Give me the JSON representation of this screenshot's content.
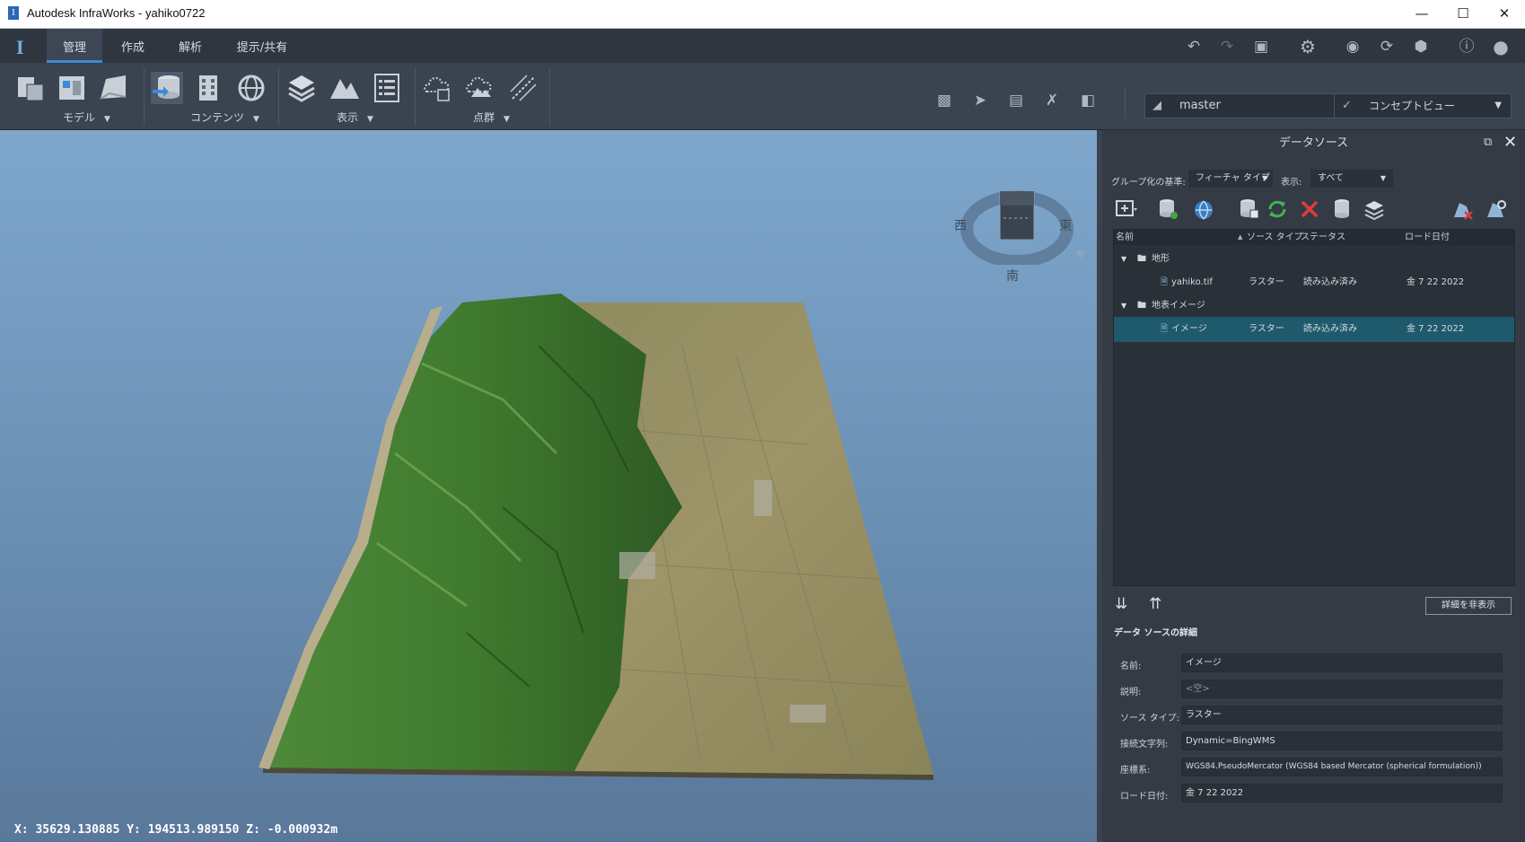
{
  "window": {
    "title": "Autodesk InfraWorks - yahiko0722",
    "app_icon": "I"
  },
  "ribbon": {
    "logo": "I",
    "tabs": [
      {
        "label": "管理",
        "active": true
      },
      {
        "label": "作成",
        "active": false
      },
      {
        "label": "解析",
        "active": false
      },
      {
        "label": "提示/共有",
        "active": false
      }
    ],
    "groups": [
      {
        "label": "モデル"
      },
      {
        "label": "コンテンツ"
      },
      {
        "label": "表示"
      },
      {
        "label": "点群"
      }
    ],
    "proposal_dropdown": "master",
    "view_dropdown": "コンセプトビュー",
    "accent": "#3b8ad6"
  },
  "viewport": {
    "coordinates": "X: 35629.130885 Y: 194513.989150 Z: -0.000932m",
    "compass": {
      "west": "西",
      "east": "東",
      "south": "南"
    }
  },
  "panel": {
    "title": "データソース",
    "group_by_label": "グループ化の基準:",
    "group_by_value": "フィーチャ タイプ",
    "show_label": "表示:",
    "show_value": "すべて",
    "columns": {
      "name": "名前",
      "source_type": "ソース タイプ",
      "status": "ステータス",
      "load_date": "ロード日付"
    },
    "rows": [
      {
        "name": "地形",
        "folder": true
      },
      {
        "name": "yahiko.tif",
        "source_type": "ラスター",
        "status": "読み込み済み",
        "date": "金 7 22 2022"
      },
      {
        "name": "地表イメージ",
        "folder": true
      },
      {
        "name": "イメージ",
        "source_type": "ラスター",
        "status": "読み込み済み",
        "date": "金 7 22 2022",
        "selected": true
      }
    ],
    "hide_details_button": "詳細を非表示",
    "details_header": "データ ソースの詳細",
    "details": [
      {
        "label": "名前:",
        "value": "イメージ"
      },
      {
        "label": "説明:",
        "value": "<空>"
      },
      {
        "label": "ソース タイプ:",
        "value": "ラスター"
      },
      {
        "label": "接続文字列:",
        "value": "Dynamic=BingWMS"
      },
      {
        "label": "座標系:",
        "value": "WGS84.PseudoMercator (WGS84 based Mercator (spherical formulation))"
      },
      {
        "label": "ロード日付:",
        "value": "金 7 22 2022"
      }
    ]
  }
}
